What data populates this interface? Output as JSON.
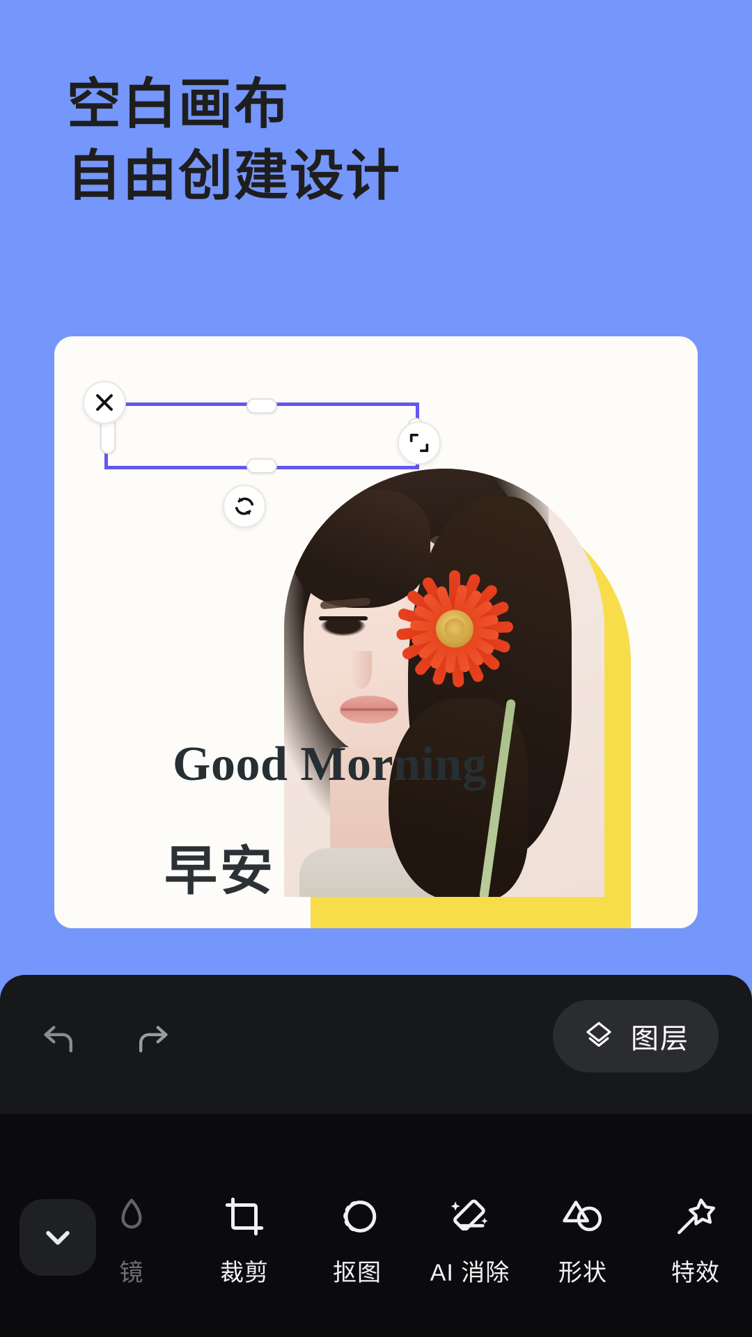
{
  "theme": {
    "background": "#7596fa",
    "card": "#fdfcf9",
    "selection_accent": "#6257f0",
    "toolbar_dark": "#0b0b0d",
    "action_bar": "#17181a",
    "photo_frame_yellow": "#f8dd4b",
    "flower_red": "#d9380f"
  },
  "hero": {
    "line1": "空白画布",
    "line2": "自由创建设计"
  },
  "canvas": {
    "text_layer": {
      "value": "Good Morning",
      "selected": true
    },
    "text_layer_secondary": {
      "value": "早安"
    },
    "selection_controls": {
      "close_icon": "close-x-icon",
      "scale_icon": "resize-corner-icon",
      "rotate_icon": "rotate-refresh-icon",
      "edge_handles": [
        "top",
        "right",
        "bottom",
        "left"
      ]
    },
    "artwork": {
      "alt_label": "portrait-with-red-flower",
      "frame_shape": "arch"
    }
  },
  "action_bar": {
    "undo_icon": "undo-arrow-icon",
    "redo_icon": "redo-arrow-icon",
    "layers_icon": "layers-stack-icon",
    "layers_label": "图层"
  },
  "toolbar": {
    "collapse_icon": "chevron-down-icon",
    "tools": [
      {
        "label": "镜",
        "icon": "filter-icon",
        "partial": true
      },
      {
        "label": "裁剪",
        "icon": "crop-icon",
        "partial": false
      },
      {
        "label": "抠图",
        "icon": "cutout-icon",
        "partial": false
      },
      {
        "label": "AI 消除",
        "icon": "ai-eraser-icon",
        "partial": false
      },
      {
        "label": "形状",
        "icon": "shape-icon",
        "partial": false
      },
      {
        "label": "特效",
        "icon": "magic-wand-icon",
        "partial": false
      }
    ]
  }
}
